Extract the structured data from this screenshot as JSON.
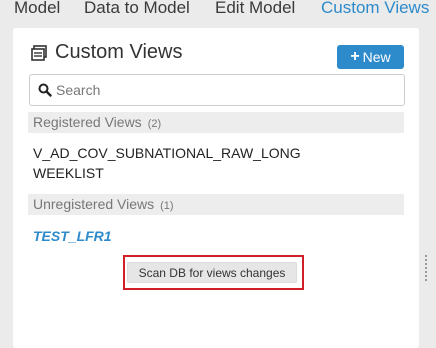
{
  "tabs": [
    {
      "label": "Model"
    },
    {
      "label": "Data to Model"
    },
    {
      "label": "Edit Model"
    },
    {
      "label": "Custom Views"
    }
  ],
  "panel": {
    "title": "Custom Views",
    "title_icon": "list-window-icon",
    "new_button": {
      "label": "New",
      "icon": "plus-icon"
    }
  },
  "search": {
    "placeholder": "Search",
    "value": "",
    "icon": "search-icon"
  },
  "registered": {
    "label": "Registered Views",
    "count": "(2)",
    "items": [
      "V_AD_COV_SUBNATIONAL_RAW_LONG",
      "WEEKLIST"
    ]
  },
  "unregistered": {
    "label": "Unregistered Views",
    "count": "(1)",
    "items": [
      "TEST_LFR1"
    ]
  },
  "scan_button": {
    "label": "Scan DB for views changes"
  },
  "colors": {
    "accent": "#2e8bcb",
    "highlight": "#d01f27",
    "background": "#ebebeb"
  }
}
